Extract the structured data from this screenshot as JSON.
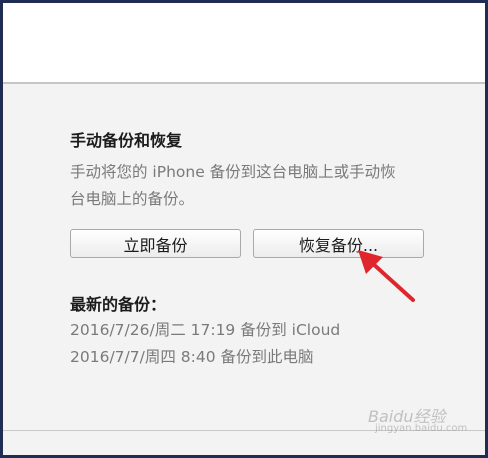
{
  "section": {
    "title": "手动备份和恢复",
    "description_line1": "手动将您的 iPhone 备份到这台电脑上或手动恢",
    "description_line2": "台电脑上的备份。"
  },
  "buttons": {
    "backup_now": "立即备份",
    "restore_backup": "恢复备份..."
  },
  "latest": {
    "title": "最新的备份：",
    "entries": [
      "2016/7/26/周二 17:19 备份到 iCloud",
      "2016/7/7/周四 8:40 备份到此电脑"
    ]
  },
  "annotation": {
    "arrow_color": "#e0262d"
  },
  "watermark": {
    "text": "Baidu经验",
    "subtext": "jingyan.baidu.com"
  }
}
